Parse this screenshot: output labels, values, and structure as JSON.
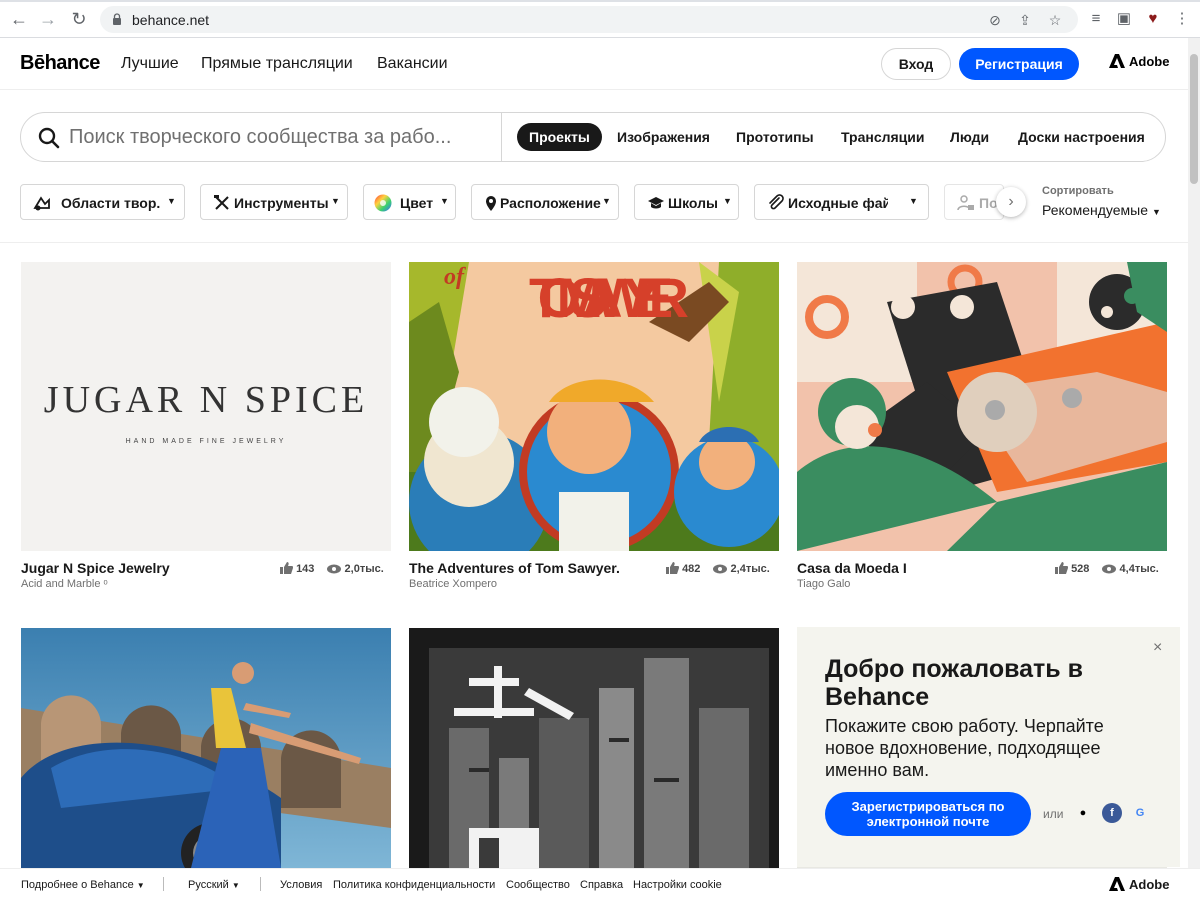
{
  "browser": {
    "url": "behance.net"
  },
  "header": {
    "logo": "Bēhance",
    "nav": [
      "Лучшие",
      "Прямые трансляции",
      "Вакансии"
    ],
    "login": "Вход",
    "signup": "Регистрация",
    "adobe": "Adobe"
  },
  "search": {
    "placeholder": "Поиск творческого сообщества за рабо...",
    "tabs": [
      "Проекты",
      "Изображения",
      "Прототипы",
      "Трансляции",
      "Люди",
      "Доски настроения"
    ],
    "active_tab": "Проекты"
  },
  "filters": {
    "items": [
      "Области твор...",
      "Инструменты",
      "Цвет",
      "Расположение",
      "Школы",
      "Исходные фай",
      "По"
    ],
    "sort_label": "Сортировать",
    "sort_value": "Рекомендуемые"
  },
  "projects": [
    {
      "title": "Jugar N Spice Jewelry",
      "owner": "Acid and Marble ᵒ",
      "likes": "143",
      "views": "2,0тыс.",
      "art_text": "JUGAR N SPICE",
      "art_sub": "HAND MADE FINE JEWELRY"
    },
    {
      "title": "The Adventures of Tom Sawyer.",
      "owner": "Beatrice Xompero",
      "likes": "482",
      "views": "2,4тыс.",
      "art_text": "TOM SAWYER",
      "art_of": "of"
    },
    {
      "title": "Casa da Moeda I",
      "owner": "Tiago Galo",
      "likes": "528",
      "views": "4,4тыс."
    }
  ],
  "welcome": {
    "title": "Добро пожаловать в Behance",
    "text": "Покажите свою работу. Черпайте новое вдохновение, подходящее именно вам.",
    "email_button": "Зарегистрироваться по электронной почте",
    "or": "или",
    "close": "×"
  },
  "footer": {
    "about": "Подробнее о Behance",
    "language": "Русский",
    "links": [
      "Условия",
      "Политика конфиденциальности",
      "Сообщество",
      "Справка",
      "Настройки cookie"
    ],
    "adobe": "Adobe"
  },
  "colors": {
    "primary_blue": "#0057ff",
    "text": "#191919",
    "muted": "#707070"
  }
}
